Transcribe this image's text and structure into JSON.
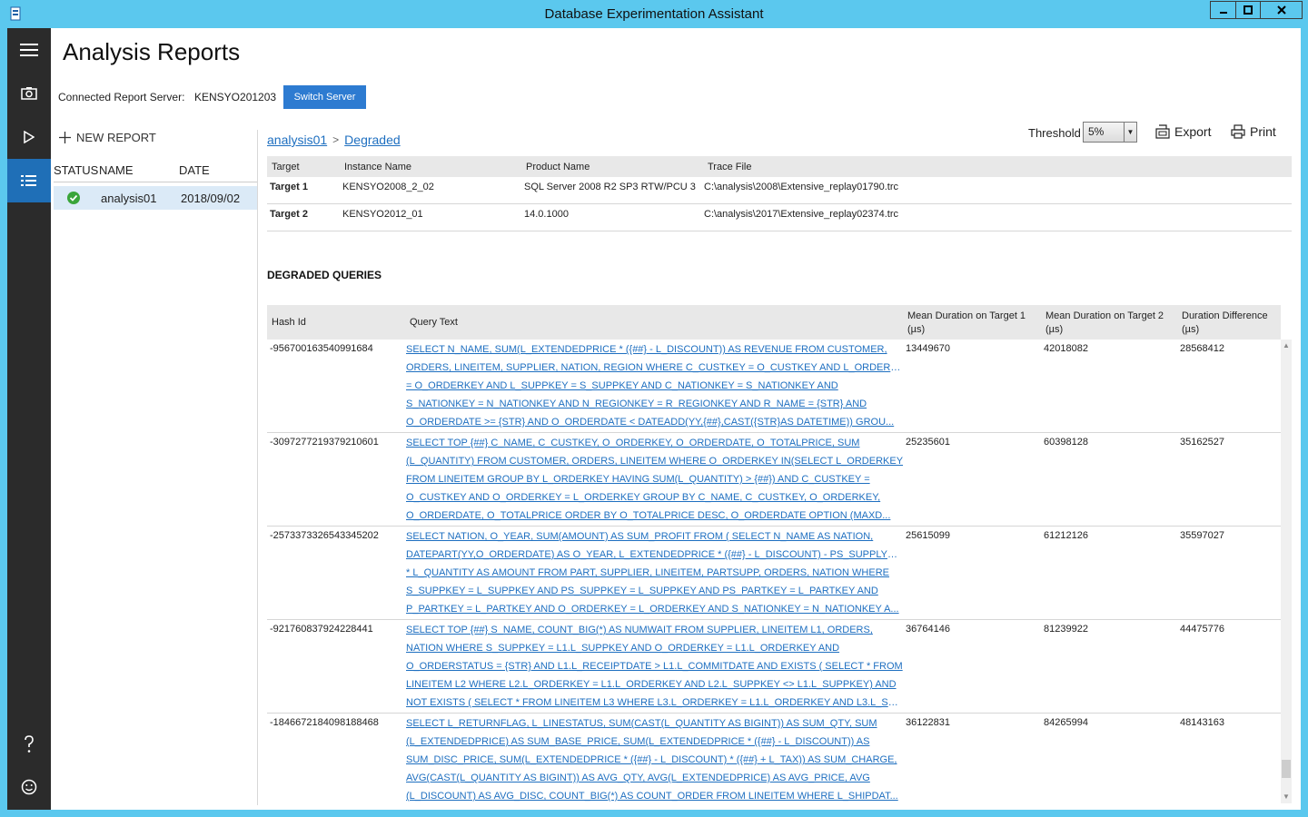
{
  "window": {
    "title": "Database Experimentation Assistant"
  },
  "nav": {
    "items": [
      {
        "name": "menu-icon"
      },
      {
        "name": "camera-icon"
      },
      {
        "name": "play-icon"
      },
      {
        "name": "analysis-icon"
      },
      {
        "name": "help-icon"
      },
      {
        "name": "feedback-icon"
      }
    ],
    "active": "analysis-icon"
  },
  "page": {
    "title": "Analysis Reports",
    "server_label": "Connected Report Server:",
    "server_name": "KENSYO201203",
    "switch_button": "Switch Server"
  },
  "reports": {
    "new_report": "NEW REPORT",
    "columns": {
      "status": "STATUS",
      "name": "NAME",
      "date": "DATE"
    },
    "items": [
      {
        "status": "ok",
        "name": "analysis01",
        "date": "2018/09/02"
      }
    ]
  },
  "breadcrumb": {
    "root": "analysis01",
    "separator": ">",
    "current": "Degraded"
  },
  "toolbar": {
    "threshold_label": "Threshold",
    "threshold_value": "5%",
    "export_label": "Export",
    "print_label": "Print"
  },
  "targets": {
    "columns": [
      "Target",
      "Instance Name",
      "Product Name",
      "Trace File"
    ],
    "rows": [
      {
        "target": "Target 1",
        "instance": "KENSYO2008_2_02",
        "product": "SQL Server 2008 R2 SP3 RTW/PCU 3",
        "trace": "C:\\analysis\\2008\\Extensive_replay01790.trc"
      },
      {
        "target": "Target 2",
        "instance": "KENSYO2012_01",
        "product": "14.0.1000",
        "trace": "C:\\analysis\\2017\\Extensive_replay02374.trc"
      }
    ]
  },
  "degraded": {
    "title": "DEGRADED QUERIES",
    "columns": {
      "hash": "Hash Id",
      "query": "Query Text",
      "mean1_line1": "Mean Duration on Target 1",
      "mean1_line2": "(µs)",
      "mean2_line1": "Mean Duration on Target 2",
      "mean2_line2": "(µs)",
      "diff_line1": "Duration Difference",
      "diff_line2": "(µs)"
    },
    "rows": [
      {
        "hash": "-956700163540991684",
        "query": [
          "SELECT N_NAME, SUM(L_EXTENDEDPRICE * ({##} - L_DISCOUNT)) AS REVENUE FROM CUSTOMER,",
          "ORDERS, LINEITEM, SUPPLIER, NATION, REGION WHERE C_CUSTKEY = O_CUSTKEY AND L_ORDERKEY",
          "= O_ORDERKEY AND L_SUPPKEY = S_SUPPKEY AND C_NATIONKEY = S_NATIONKEY AND",
          "S_NATIONKEY = N_NATIONKEY AND N_REGIONKEY = R_REGIONKEY AND R_NAME = {STR} AND",
          "O_ORDERDATE >= {STR} AND O_ORDERDATE < DATEADD(YY,{##},CAST({STR}AS DATETIME)) GROU..."
        ],
        "mean1": "13449670",
        "mean2": "42018082",
        "diff": "28568412"
      },
      {
        "hash": "-3097277219379210601",
        "query": [
          "SELECT TOP {##} C_NAME, C_CUSTKEY, O_ORDERKEY, O_ORDERDATE, O_TOTALPRICE, SUM",
          "(L_QUANTITY) FROM CUSTOMER, ORDERS, LINEITEM WHERE O_ORDERKEY IN(SELECT L_ORDERKEY",
          "FROM LINEITEM GROUP BY L_ORDERKEY HAVING SUM(L_QUANTITY) > {##}) AND C_CUSTKEY =",
          "O_CUSTKEY AND O_ORDERKEY = L_ORDERKEY GROUP BY C_NAME, C_CUSTKEY, O_ORDERKEY,",
          "O_ORDERDATE, O_TOTALPRICE ORDER BY O_TOTALPRICE DESC, O_ORDERDATE OPTION (MAXD..."
        ],
        "mean1": "25235601",
        "mean2": "60398128",
        "diff": "35162527"
      },
      {
        "hash": "-2573373326543345202",
        "query": [
          "SELECT NATION, O_YEAR, SUM(AMOUNT) AS SUM_PROFIT FROM ( SELECT N_NAME AS NATION,",
          "DATEPART(YY,O_ORDERDATE) AS O_YEAR, L_EXTENDEDPRICE * ({##} - L_DISCOUNT) - PS_SUPPLYCOST",
          "* L_QUANTITY AS AMOUNT FROM PART, SUPPLIER, LINEITEM, PARTSUPP, ORDERS, NATION WHERE",
          "S_SUPPKEY = L_SUPPKEY AND PS_SUPPKEY = L_SUPPKEY AND PS_PARTKEY = L_PARTKEY AND",
          "P_PARTKEY = L_PARTKEY AND O_ORDERKEY = L_ORDERKEY AND S_NATIONKEY = N_NATIONKEY A..."
        ],
        "mean1": "25615099",
        "mean2": "61212126",
        "diff": "35597027"
      },
      {
        "hash": "-921760837924228441",
        "query": [
          "SELECT TOP {##} S_NAME, COUNT_BIG(*) AS NUMWAIT FROM SUPPLIER, LINEITEM L1, ORDERS,",
          "NATION WHERE S_SUPPKEY = L1.L_SUPPKEY AND O_ORDERKEY = L1.L_ORDERKEY AND",
          "O_ORDERSTATUS = {STR} AND L1.L_RECEIPTDATE > L1.L_COMMITDATE AND EXISTS ( SELECT * FROM",
          "LINEITEM L2 WHERE L2.L_ORDERKEY = L1.L_ORDERKEY AND L2.L_SUPPKEY <> L1.L_SUPPKEY) AND",
          "NOT EXISTS ( SELECT * FROM LINEITEM L3 WHERE L3.L_ORDERKEY = L1.L_ORDERKEY AND L3.L_SUP..."
        ],
        "mean1": "36764146",
        "mean2": "81239922",
        "diff": "44475776"
      },
      {
        "hash": "-1846672184098188468",
        "query": [
          "SELECT L_RETURNFLAG, L_LINESTATUS, SUM(CAST(L_QUANTITY AS BIGINT)) AS SUM_QTY, SUM",
          "(L_EXTENDEDPRICE) AS SUM_BASE_PRICE, SUM(L_EXTENDEDPRICE * ({##} - L_DISCOUNT)) AS",
          "SUM_DISC_PRICE, SUM(L_EXTENDEDPRICE * ({##} - L_DISCOUNT) * ({##} + L_TAX)) AS SUM_CHARGE,",
          "AVG(CAST(L_QUANTITY AS BIGINT)) AS AVG_QTY, AVG(L_EXTENDEDPRICE) AS AVG_PRICE, AVG",
          "(L_DISCOUNT) AS AVG_DISC, COUNT_BIG(*) AS COUNT_ORDER FROM LINEITEM WHERE L_SHIPDAT..."
        ],
        "mean1": "36122831",
        "mean2": "84265994",
        "diff": "48143163"
      }
    ]
  },
  "colors": {
    "titlebar": "#5bc8ee",
    "rail": "#2b2b2b",
    "rail_active": "#1f6fb7",
    "accent_button": "#2d7bd1",
    "link": "#1e6fc0",
    "selected_row": "#dbeaf7",
    "status_ok": "#3aa53a"
  }
}
